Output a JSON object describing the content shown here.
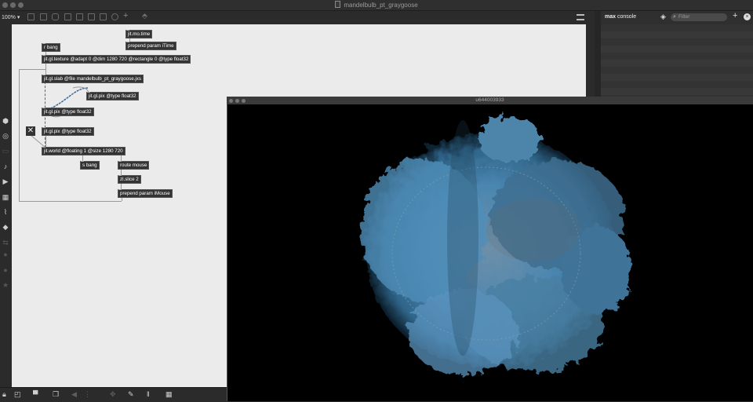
{
  "window": {
    "title": "mandelbulb_pt_graygoose"
  },
  "toolbar": {
    "zoom": "100%"
  },
  "patcher": {
    "objects": {
      "jit_mo_time": "jit.mo.time",
      "prepend_time": "prepend param iTime",
      "r_bang": "r bang",
      "jit_gl_texture": "jit.gl.texture @adapt 0 @dim 1280 720 @rectangle 0 @type float32",
      "jit_gl_slab": "jit.gl.slab @file mandelbulb_pt_graygoose.jxs",
      "jit_gl_pix_1": "jit.gl.pix @type float32",
      "jit_gl_pix_2": "jit.gl.pix @type float32",
      "jit_gl_pix_3": "jit.gl.pix @type float32",
      "jit_world": "jit.world @floating 1 @size 1280 720",
      "s_bang": "s bang",
      "route_mouse": "route mouse",
      "zl_slice": "zl.slice 2",
      "prepend_mouse": "prepend param iMouse"
    }
  },
  "console": {
    "title_bold": "max",
    "title_rest": " console",
    "filter_placeholder": "Filter"
  },
  "render_window": {
    "title": "u644003933"
  },
  "colors": {
    "canvas": "#ebebeb",
    "object": "#333333",
    "fractal": "#4a86b0",
    "render_bg": "#000000"
  }
}
